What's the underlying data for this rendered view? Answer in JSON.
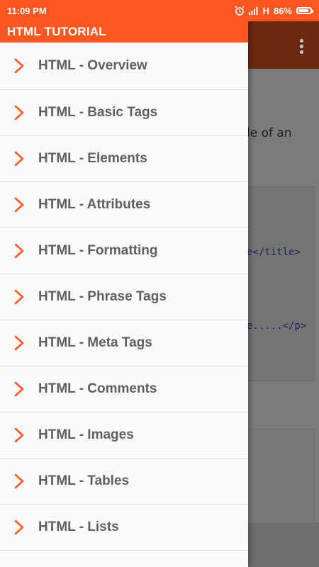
{
  "status_bar": {
    "time": "11:09 PM",
    "network": "H",
    "battery": "86%"
  },
  "drawer": {
    "title": "HTML TUTORIAL",
    "items": [
      {
        "label": "HTML - Overview"
      },
      {
        "label": "HTML - Basic Tags"
      },
      {
        "label": "HTML - Elements"
      },
      {
        "label": "HTML - Attributes"
      },
      {
        "label": "HTML - Formatting"
      },
      {
        "label": "HTML - Phrase Tags"
      },
      {
        "label": "HTML - Meta Tags"
      },
      {
        "label": "HTML - Comments"
      },
      {
        "label": "HTML - Images"
      },
      {
        "label": "HTML - Tables"
      },
      {
        "label": "HTML - Lists"
      }
    ]
  },
  "background_page": {
    "text_fragment": "le of an",
    "code_lines": [
      "e</title>",
      "e.....</p>"
    ]
  },
  "colors": {
    "accent": "#ff5722",
    "item_text": "#5f5f5f",
    "chevron": "#ff5722"
  }
}
